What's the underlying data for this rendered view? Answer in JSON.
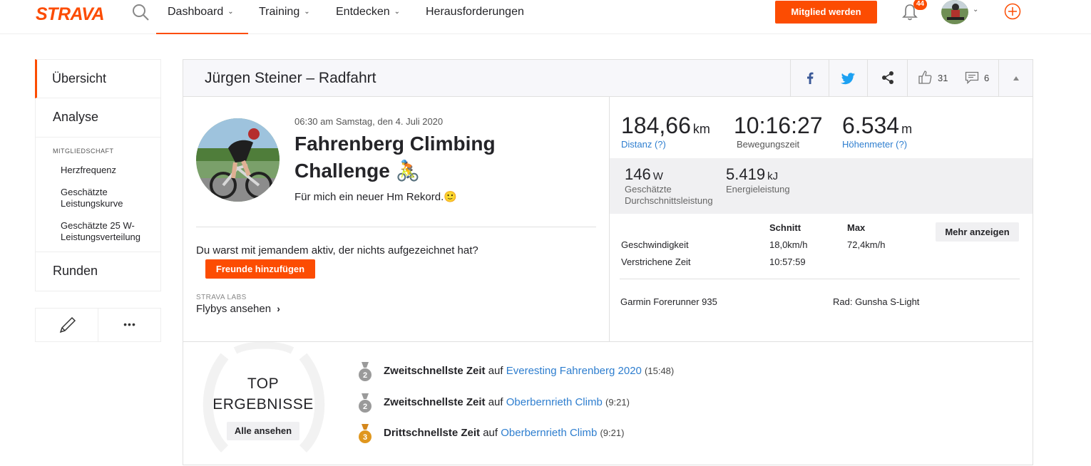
{
  "nav": {
    "logo": "STRAVA",
    "items": [
      {
        "label": "Dashboard"
      },
      {
        "label": "Training"
      },
      {
        "label": "Entdecken"
      },
      {
        "label": "Herausforderungen"
      }
    ],
    "member_button": "Mitglied werden",
    "notification_count": "44"
  },
  "sidebar": {
    "items": [
      {
        "label": "Übersicht"
      },
      {
        "label": "Analyse"
      },
      {
        "label": "Runden"
      }
    ],
    "membership_title": "MITGLIEDSCHAFT",
    "membership_items": [
      {
        "label": "Herzfrequenz"
      },
      {
        "label": "Geschätzte Leistungskurve"
      },
      {
        "label": "Geschätzte 25 W-Leistungsverteilung"
      }
    ],
    "more_label": "•••"
  },
  "header": {
    "title": "Jürgen Steiner – Radfahrt",
    "kudos": "31",
    "comments": "6"
  },
  "activity": {
    "date": "06:30 am Samstag, den 4. Juli 2020",
    "name": "Fahrenberg Climbing Challenge 🚴",
    "description": "Für mich ein neuer Hm Rekord.🙂",
    "invite_question": "Du warst mit jemandem aktiv, der nichts aufgezeichnet hat?",
    "invite_button": "Freunde hinzufügen",
    "labs_title": "STRAVA LABS",
    "labs_link": "Flybys ansehen"
  },
  "stats": {
    "distance": {
      "value": "184,66",
      "unit": "km",
      "label": "Distanz (?)"
    },
    "moving_time": {
      "value": "10:16:27",
      "label": "Bewegungszeit"
    },
    "elevation": {
      "value": "6.534",
      "unit": "m",
      "label": "Höhenmeter (?)"
    },
    "power": {
      "value": "146",
      "unit": "W",
      "label": "Geschätzte Durchschnittsleistung"
    },
    "energy": {
      "value": "5.419",
      "unit": "kJ",
      "label": "Energieleistung"
    }
  },
  "table": {
    "col_avg": "Schnitt",
    "col_max": "Max",
    "more_button": "Mehr anzeigen",
    "rows": [
      {
        "label": "Geschwindigkeit",
        "avg": "18,0km/h",
        "max": "72,4km/h"
      },
      {
        "label": "Verstrichene Zeit",
        "avg": "10:57:59",
        "max": ""
      }
    ]
  },
  "devices": {
    "watch": "Garmin Forerunner 935",
    "bike": "Rad: Gunsha S-Light"
  },
  "top_results": {
    "title_line1": "TOP",
    "title_line2": "ERGEBNISSE",
    "all_button": "Alle ansehen",
    "items": [
      {
        "rank": "2",
        "label": "Zweitschnellste Zeit",
        "on": "auf",
        "segment": "Everesting Fahrenberg 2020",
        "time": "(15:48)",
        "color": "#9a9a9a"
      },
      {
        "rank": "2",
        "label": "Zweitschnellste Zeit",
        "on": "auf",
        "segment": "Oberbernrieth Climb",
        "time": "(9:21)",
        "color": "#9a9a9a"
      },
      {
        "rank": "3",
        "label": "Drittschnellste Zeit",
        "on": "auf",
        "segment": "Oberbernrieth Climb",
        "time": "(9:21)",
        "color": "#d4871c"
      }
    ]
  },
  "colors": {
    "brand": "#fc4c02",
    "link": "#2e7ecf"
  }
}
